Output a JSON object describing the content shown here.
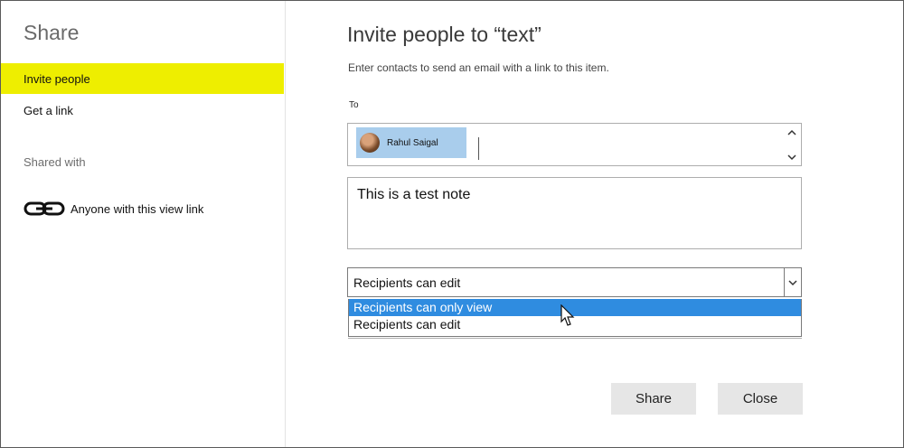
{
  "sidebar": {
    "title": "Share",
    "items": [
      {
        "label": "Invite people",
        "active": true
      },
      {
        "label": "Get a link",
        "active": false
      }
    ],
    "shared_with_label": "Shared with",
    "shared_entries": [
      {
        "label": "Anyone with this view link",
        "icon": "link-icon"
      }
    ]
  },
  "main": {
    "title": "Invite people to “text”",
    "subtitle": "Enter contacts to send an email with a link to this item.",
    "to_label": "To",
    "recipients": [
      {
        "name": "Rahul Saigal",
        "icon": "avatar"
      }
    ],
    "note": "This is a test note",
    "permission": {
      "selected_value": "Recipients can edit",
      "options": [
        {
          "label": "Recipients can only view",
          "highlighted": true
        },
        {
          "label": "Recipients can edit",
          "highlighted": false
        }
      ]
    },
    "buttons": {
      "share_label": "Share",
      "close_label": "Close"
    }
  },
  "colors": {
    "active_nav": "#eeee00",
    "chip": "#a9cdec",
    "highlight": "#2f8ce0",
    "button": "#e6e6e6"
  }
}
